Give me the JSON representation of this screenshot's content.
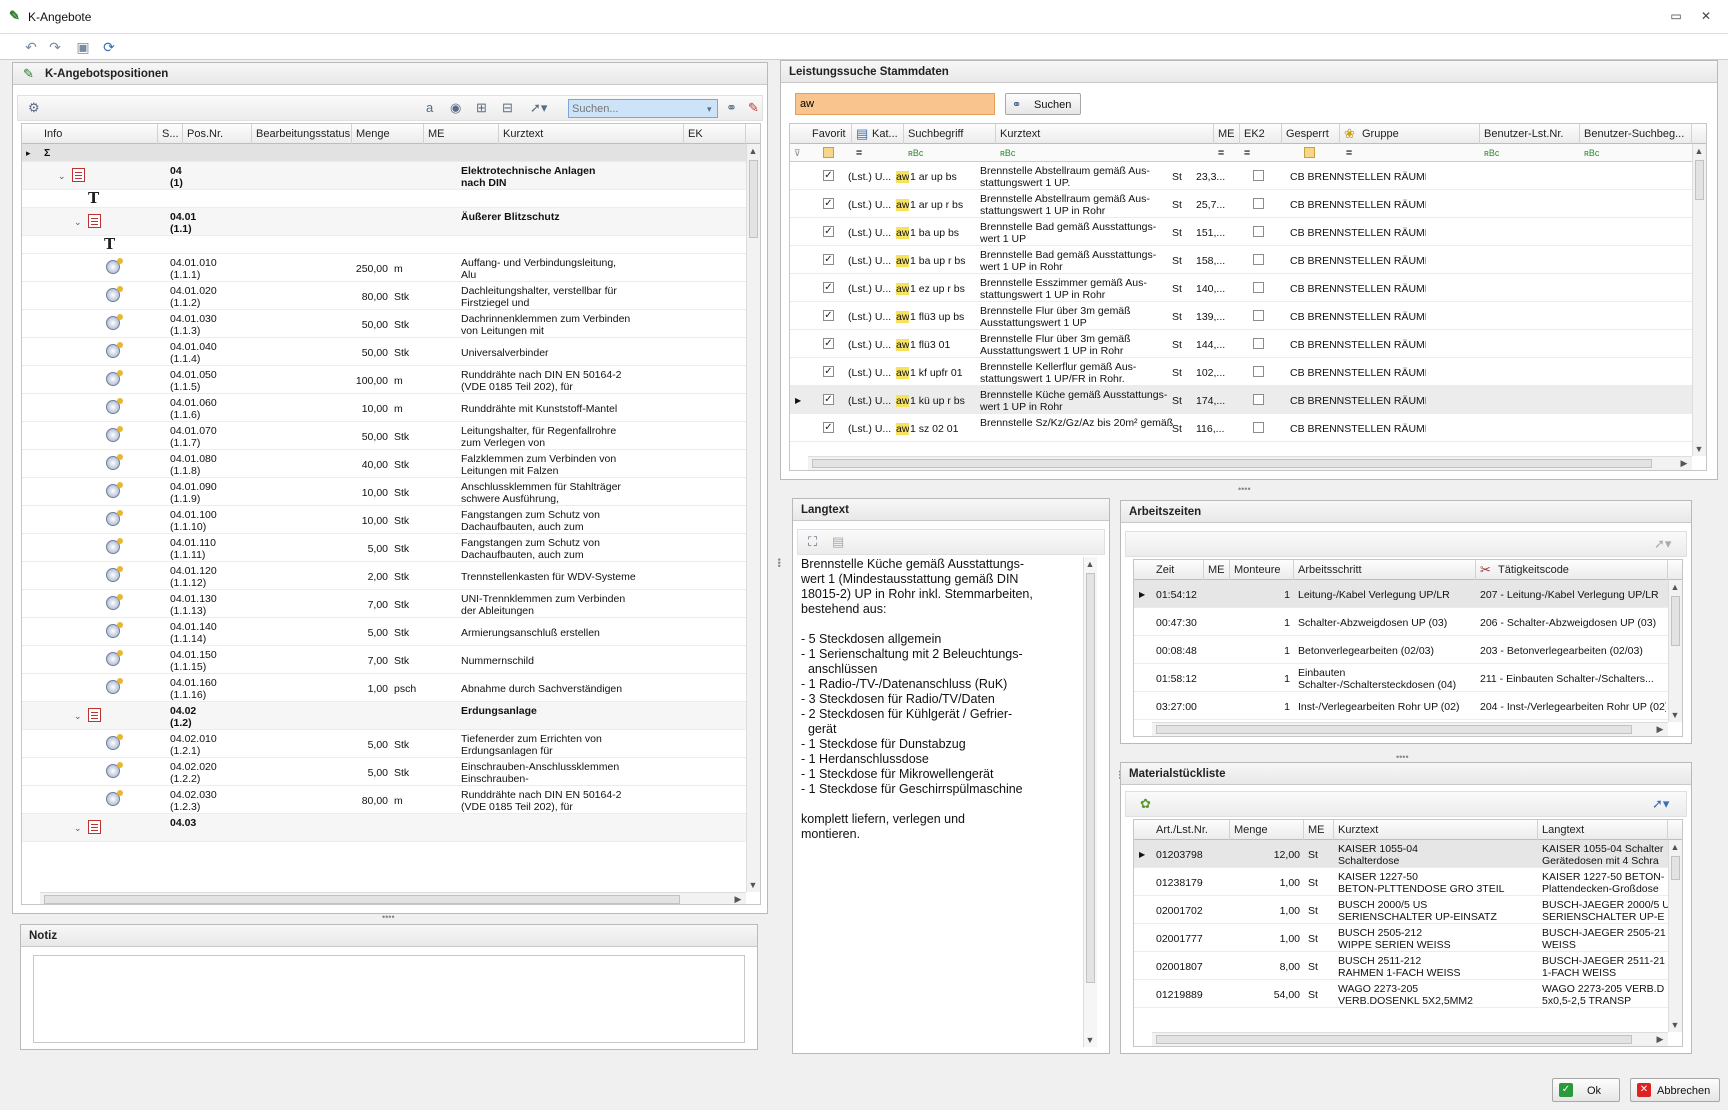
{
  "window": {
    "title": "K-Angebote"
  },
  "left_panel": {
    "title": "K-Angebotspositionen",
    "search_placeholder": "Suchen...",
    "columns": [
      "Info",
      "S...",
      "Pos.Nr.",
      "Bearbeitungsstatus",
      "Menge",
      "ME",
      "Kurztext",
      "EK"
    ],
    "sum_symbol": "Σ",
    "rows": [
      {
        "type": "group",
        "level": 0,
        "pos": "04",
        "pos2": "(1)",
        "text": "Elektrotechnische Anlagen",
        "text2": "nach DIN"
      },
      {
        "type": "text",
        "level": 0
      },
      {
        "type": "group",
        "level": 1,
        "pos": "04.01",
        "pos2": "(1.1)",
        "text": "Äußerer Blitzschutz",
        "text2": ""
      },
      {
        "type": "text",
        "level": 1
      },
      {
        "type": "item",
        "pos": "04.01.010",
        "pos2": "(1.1.1)",
        "menge": "250,00",
        "me": "m",
        "text": "Auffang- und Verbindungsleitung,",
        "text2": "Alu"
      },
      {
        "type": "item",
        "pos": "04.01.020",
        "pos2": "(1.1.2)",
        "menge": "80,00",
        "me": "Stk",
        "text": "Dachleitungshalter, verstellbar für",
        "text2": "Firstziegel und"
      },
      {
        "type": "item",
        "pos": "04.01.030",
        "pos2": "(1.1.3)",
        "menge": "50,00",
        "me": "Stk",
        "text": "Dachrinnenklemmen zum Verbinden",
        "text2": "von Leitungen mit"
      },
      {
        "type": "item",
        "pos": "04.01.040",
        "pos2": "(1.1.4)",
        "menge": "50,00",
        "me": "Stk",
        "text": "Universalverbinder",
        "text2": ""
      },
      {
        "type": "item",
        "pos": "04.01.050",
        "pos2": "(1.1.5)",
        "menge": "100,00",
        "me": "m",
        "text": "Runddrähte nach DIN EN 50164-2",
        "text2": "(VDE 0185 Teil 202), für"
      },
      {
        "type": "item",
        "pos": "04.01.060",
        "pos2": "(1.1.6)",
        "menge": "10,00",
        "me": "m",
        "text": "Runddrähte mit Kunststoff-Mantel",
        "text2": ""
      },
      {
        "type": "item",
        "pos": "04.01.070",
        "pos2": "(1.1.7)",
        "menge": "50,00",
        "me": "Stk",
        "text": "Leitungshalter, für Regenfallrohre",
        "text2": "zum Verlegen von"
      },
      {
        "type": "item",
        "pos": "04.01.080",
        "pos2": "(1.1.8)",
        "menge": "40,00",
        "me": "Stk",
        "text": "Falzklemmen zum Verbinden von",
        "text2": "Leitungen mit Falzen"
      },
      {
        "type": "item",
        "pos": "04.01.090",
        "pos2": "(1.1.9)",
        "menge": "10,00",
        "me": "Stk",
        "text": "Anschlussklemmen für Stahlträger",
        "text2": "schwere Ausführung,"
      },
      {
        "type": "item",
        "pos": "04.01.100",
        "pos2": "(1.1.10)",
        "menge": "10,00",
        "me": "Stk",
        "text": "Fangstangen zum Schutz von",
        "text2": "Dachaufbauten, auch zum"
      },
      {
        "type": "item",
        "pos": "04.01.110",
        "pos2": "(1.1.11)",
        "menge": "5,00",
        "me": "Stk",
        "text": "Fangstangen zum Schutz von",
        "text2": "Dachaufbauten, auch zum"
      },
      {
        "type": "item",
        "pos": "04.01.120",
        "pos2": "(1.1.12)",
        "menge": "2,00",
        "me": "Stk",
        "text": "Trennstellenkasten für WDV-Systeme",
        "text2": ""
      },
      {
        "type": "item",
        "pos": "04.01.130",
        "pos2": "(1.1.13)",
        "menge": "7,00",
        "me": "Stk",
        "text": "UNI-Trennklemmen zum Verbinden",
        "text2": "der Ableitungen"
      },
      {
        "type": "item",
        "pos": "04.01.140",
        "pos2": "(1.1.14)",
        "menge": "5,00",
        "me": "Stk",
        "text": "Armierungsanschluß erstellen",
        "text2": ""
      },
      {
        "type": "item",
        "pos": "04.01.150",
        "pos2": "(1.1.15)",
        "menge": "7,00",
        "me": "Stk",
        "text": "Nummernschild",
        "text2": ""
      },
      {
        "type": "item",
        "pos": "04.01.160",
        "pos2": "(1.1.16)",
        "menge": "1,00",
        "me": "psch",
        "text": "Abnahme durch Sachverständigen",
        "text2": ""
      },
      {
        "type": "group",
        "level": 1,
        "pos": "04.02",
        "pos2": "(1.2)",
        "text": "Erdungsanlage",
        "text2": ""
      },
      {
        "type": "item",
        "pos": "04.02.010",
        "pos2": "(1.2.1)",
        "menge": "5,00",
        "me": "Stk",
        "text": "Tiefenerder zum Errichten von",
        "text2": "Erdungsanlagen für"
      },
      {
        "type": "item",
        "pos": "04.02.020",
        "pos2": "(1.2.2)",
        "menge": "5,00",
        "me": "Stk",
        "text": "Einschrauben-Anschlussklemmen",
        "text2": "Einschrauben-"
      },
      {
        "type": "item",
        "pos": "04.02.030",
        "pos2": "(1.2.3)",
        "menge": "80,00",
        "me": "m",
        "text": "Runddrähte nach DIN EN 50164-2",
        "text2": "(VDE 0185 Teil 202), für"
      },
      {
        "type": "groupcut",
        "level": 1,
        "pos": "04.03",
        "pos2": "",
        "text": "",
        "text2": ""
      }
    ]
  },
  "notiz": {
    "title": "Notiz"
  },
  "search_panel": {
    "title": "Leistungssuche Stammdaten",
    "query": "aw",
    "search_button": "Suchen",
    "columns": [
      "Favorit",
      "Kat...",
      "Suchbegriff",
      "Kurztext",
      "ME",
      "EK2",
      "Gesperrt",
      "Gruppe",
      "Benutzer-Lst.Nr.",
      "Benutzer-Suchbeg..."
    ],
    "filter_eq": "=",
    "filter_abc": "ʀBc",
    "rows": [
      {
        "kat": "(Lst.) U...",
        "hl": "aw",
        "such": "1 ar up bs",
        "k1": "Brennstelle Abstellraum gemäß Aus-",
        "k2": "stattungswert 1 UP.",
        "me": "St",
        "ek2": "23,3...",
        "gruppe": "CB BRENNSTELLEN RÄUME"
      },
      {
        "kat": "(Lst.) U...",
        "hl": "aw",
        "such": "1 ar up r bs",
        "k1": "Brennstelle Abstellraum gemäß Aus-",
        "k2": "stattungswert 1 UP in Rohr",
        "me": "St",
        "ek2": "25,7...",
        "gruppe": "CB BRENNSTELLEN RÄUME"
      },
      {
        "kat": "(Lst.) U...",
        "hl": "aw",
        "such": "1 ba up bs",
        "k1": "Brennstelle Bad gemäß Ausstattungs-",
        "k2": "wert 1 UP",
        "me": "St",
        "ek2": "151,...",
        "gruppe": "CB BRENNSTELLEN RÄUME"
      },
      {
        "kat": "(Lst.) U...",
        "hl": "aw",
        "such": "1 ba up r bs",
        "k1": "Brennstelle Bad gemäß Ausstattungs-",
        "k2": "wert 1 UP in Rohr",
        "me": "St",
        "ek2": "158,...",
        "gruppe": "CB BRENNSTELLEN RÄUME"
      },
      {
        "kat": "(Lst.) U...",
        "hl": "aw",
        "such": "1 ez up r bs",
        "k1": "Brennstelle Esszimmer gemäß Aus-",
        "k2": "stattungswert 1 UP in Rohr",
        "me": "St",
        "ek2": "140,...",
        "gruppe": "CB BRENNSTELLEN RÄUME"
      },
      {
        "kat": "(Lst.) U...",
        "hl": "aw",
        "such": "1 flü3 up bs",
        "k1": "Brennstelle Flur über 3m gemäß",
        "k2": "Ausstattungswert 1 UP",
        "me": "St",
        "ek2": "139,...",
        "gruppe": "CB BRENNSTELLEN RÄUME"
      },
      {
        "kat": "(Lst.) U...",
        "hl": "aw",
        "such": "1 flü3 01",
        "k1": "Brennstelle Flur über 3m gemäß",
        "k2": "Ausstattungswert 1 UP in Rohr",
        "me": "St",
        "ek2": "144,...",
        "gruppe": "CB BRENNSTELLEN RÄUME"
      },
      {
        "kat": "(Lst.) U...",
        "hl": "aw",
        "such": "1 kf upfr 01",
        "k1": "Brennstelle Kellerflur gemäß Aus-",
        "k2": "stattungswert 1 UP/FR in Rohr.",
        "me": "St",
        "ek2": "102,...",
        "gruppe": "CB BRENNSTELLEN RÄUME"
      },
      {
        "kat": "(Lst.) U...",
        "hl": "aw",
        "such": "1 kü up r bs",
        "k1": "Brennstelle Küche gemäß Ausstattungs-",
        "k2": "wert 1 UP in Rohr",
        "me": "St",
        "ek2": "174,...",
        "gruppe": "CB BRENNSTELLEN RÄUME"
      },
      {
        "kat": "(Lst.) U...",
        "hl": "aw",
        "such": "1 sz 02 01",
        "k1": "Brennstelle Sz/Kz/Gz/Az bis 20m² gemäß",
        "k2": "",
        "me": "St",
        "ek2": "116,...",
        "gruppe": "CB BRENNSTELLEN RÄUME"
      }
    ]
  },
  "langtext": {
    "title": "Langtext",
    "lines": [
      "Brennstelle Küche gemäß Ausstattungs-",
      "wert 1 (Mindestausstattung gemäß DIN",
      "18015-2) UP in Rohr inkl. Stemmarbeiten,",
      "bestehend aus:",
      "",
      "- 5 Steckdosen allgemein",
      "- 1 Serienschaltung mit 2 Beleuchtungs-",
      "  anschlüssen",
      "- 1 Radio-/TV-/Datenanschluss (RuK)",
      "- 3 Steckdosen für Radio/TV/Daten",
      "- 2 Steckdosen für Kühlgerät / Gefrier-",
      "  gerät",
      "- 1 Steckdose für Dunstabzug",
      "- 1 Herdanschlussdose",
      "- 1 Steckdose für Mikrowellengerät",
      "- 1 Steckdose für Geschirrspülmaschine",
      "",
      "komplett liefern, verlegen und",
      "montieren."
    ]
  },
  "arbeitszeiten": {
    "title": "Arbeitszeiten",
    "columns": [
      "Zeit",
      "ME",
      "Monteure",
      "Arbeitsschritt",
      "Tätigkeitscode"
    ],
    "rows": [
      {
        "zeit": "01:54:12",
        "me": "",
        "monteure": "1",
        "schritt": "Leitung-/Kabel Verlegung UP/LR",
        "schritt2": "",
        "code": "207 - Leitung-/Kabel Verlegung UP/LR"
      },
      {
        "zeit": "00:47:30",
        "me": "",
        "monteure": "1",
        "schritt": "Schalter-Abzweigdosen UP (03)",
        "schritt2": "",
        "code": "206 - Schalter-Abzweigdosen UP (03)"
      },
      {
        "zeit": "00:08:48",
        "me": "",
        "monteure": "1",
        "schritt": "Betonverlegearbeiten (02/03)",
        "schritt2": "",
        "code": "203 - Betonverlegearbeiten (02/03)"
      },
      {
        "zeit": "01:58:12",
        "me": "",
        "monteure": "1",
        "schritt": "Einbauten",
        "schritt2": "Schalter-/Schaltersteckdosen (04)",
        "code": "211 - Einbauten Schalter-/Schalters..."
      },
      {
        "zeit": "03:27:00",
        "me": "",
        "monteure": "1",
        "schritt": "Inst-/Verlegearbeiten Rohr UP (02)",
        "schritt2": "",
        "code": "204 - Inst-/Verlegearbeiten Rohr UP (02)"
      }
    ]
  },
  "material": {
    "title": "Materialstückliste",
    "columns": [
      "Art./Lst.Nr.",
      "Menge",
      "ME",
      "Kurztext",
      "Langtext"
    ],
    "rows": [
      {
        "nr": "01203798",
        "menge": "12,00",
        "me": "St",
        "k1": "KAISER 1055-04",
        "k2": "Schalterdose",
        "l1": "KAISER 1055-04 Schalter",
        "l2": "Gerätedosen mit 4 Schra"
      },
      {
        "nr": "01238179",
        "menge": "1,00",
        "me": "St",
        "k1": "KAISER 1227-50",
        "k2": "BETON-PLTTENDOSE GRO 3TEIL",
        "l1": "KAISER 1227-50 BETON-",
        "l2": "Plattendecken-Großdose"
      },
      {
        "nr": "02001702",
        "menge": "1,00",
        "me": "St",
        "k1": "BUSCH 2000/5 US",
        "k2": "SERIENSCHALTER UP-EINSATZ",
        "l1": "BUSCH-JAEGER 2000/5 U",
        "l2": "SERIENSCHALTER UP-E"
      },
      {
        "nr": "02001777",
        "menge": "1,00",
        "me": "St",
        "k1": "BUSCH 2505-212",
        "k2": "WIPPE SERIEN WEISS",
        "l1": "BUSCH-JAEGER 2505-21",
        "l2": "WEISS"
      },
      {
        "nr": "02001807",
        "menge": "8,00",
        "me": "St",
        "k1": "BUSCH 2511-212",
        "k2": "RAHMEN 1-FACH WEISS",
        "l1": "BUSCH-JAEGER 2511-21",
        "l2": "1-FACH WEISS"
      },
      {
        "nr": "01219889",
        "menge": "54,00",
        "me": "St",
        "k1": "WAGO 2273-205",
        "k2": "VERB.DOSENKL 5X2,5MM2",
        "l1": "WAGO 2273-205 VERB.D",
        "l2": "5x0,5-2,5 TRANSP"
      }
    ]
  },
  "footer": {
    "ok": "Ok",
    "cancel": "Abbrechen"
  }
}
